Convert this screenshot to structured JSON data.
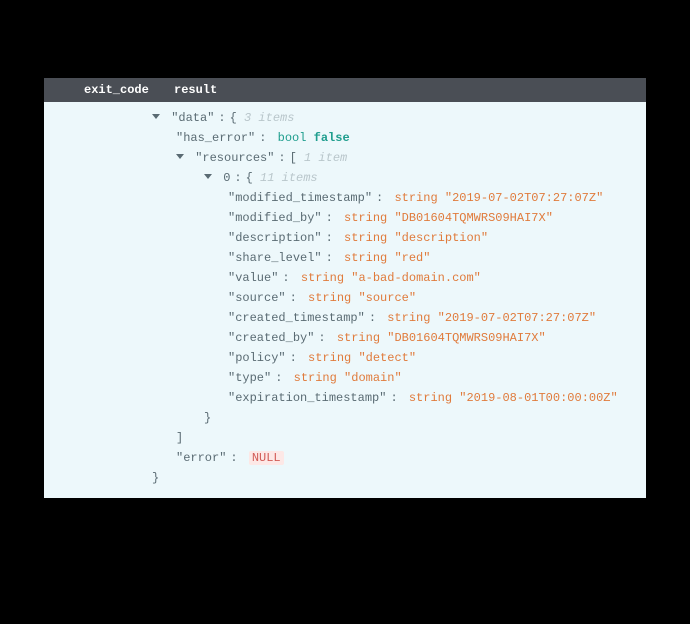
{
  "header": {
    "col_exit_code": "exit_code",
    "col_result": "result"
  },
  "tree": {
    "data_key": "data",
    "data_count": "3 items",
    "has_error_key": "has_error",
    "has_error_type": "bool",
    "has_error_value": "false",
    "resources_key": "resources",
    "resources_count": "1 item",
    "item_index": "0",
    "item_count": "11 items",
    "fields": {
      "modified_timestamp": {
        "key": "modified_timestamp",
        "type": "string",
        "value": "2019-07-02T07:27:07Z"
      },
      "modified_by": {
        "key": "modified_by",
        "type": "string",
        "value": "DB01604TQMWRS09HAI7X"
      },
      "description": {
        "key": "description",
        "type": "string",
        "value": "description"
      },
      "share_level": {
        "key": "share_level",
        "type": "string",
        "value": "red"
      },
      "value": {
        "key": "value",
        "type": "string",
        "value": "a-bad-domain.com"
      },
      "source": {
        "key": "source",
        "type": "string",
        "value": "source"
      },
      "created_timestamp": {
        "key": "created_timestamp",
        "type": "string",
        "value": "2019-07-02T07:27:07Z"
      },
      "created_by": {
        "key": "created_by",
        "type": "string",
        "value": "DB01604TQMWRS09HAI7X"
      },
      "policy": {
        "key": "policy",
        "type": "string",
        "value": "detect"
      },
      "type": {
        "key": "type",
        "type": "string",
        "value": "domain"
      },
      "expiration_timestamp": {
        "key": "expiration_timestamp",
        "type": "string",
        "value": "2019-08-01T00:00:00Z"
      }
    },
    "error_key": "error",
    "error_value": "NULL"
  }
}
